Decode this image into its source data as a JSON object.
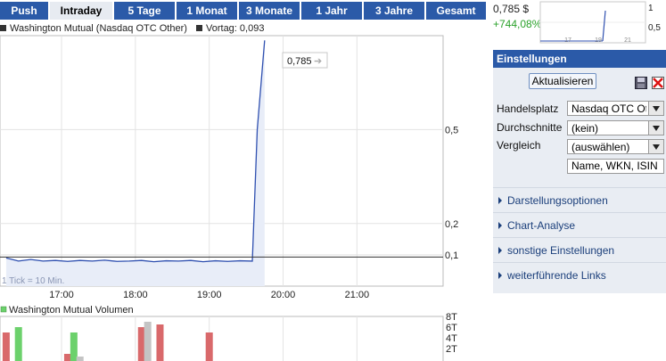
{
  "tabs": [
    {
      "label": "Push",
      "active": false
    },
    {
      "label": "Intraday",
      "active": true
    },
    {
      "label": "5 Tage",
      "active": false
    },
    {
      "label": "1 Monat",
      "active": false
    },
    {
      "label": "3 Monate",
      "active": false
    },
    {
      "label": "1 Jahr",
      "active": false
    },
    {
      "label": "3 Jahre",
      "active": false
    },
    {
      "label": "Gesamt",
      "active": false
    }
  ],
  "legend": {
    "series_name": "Washington Mutual (Nasdaq OTC Other)",
    "prev_close_label": "Vortag: 0,093"
  },
  "main_chart": {
    "callout": "0,785",
    "tick_note": "1 Tick = 10 Min.",
    "y_ticks": [
      "0,5",
      "0,2",
      "0,1"
    ],
    "x_ticks": [
      "17:00",
      "18:00",
      "19:00",
      "20:00",
      "21:00"
    ]
  },
  "volume_chart": {
    "title": "Washington Mutual Volumen",
    "y_ticks": [
      "8T",
      "6T",
      "4T",
      "2T"
    ]
  },
  "quote": {
    "price": "0,785 $",
    "change": "+744,08%"
  },
  "mini_chart": {
    "y_ticks": [
      "1",
      "0,5"
    ],
    "x_ticks": [
      "17",
      "19",
      "21"
    ]
  },
  "settings": {
    "title": "Einstellungen",
    "update_button": "Aktualisieren",
    "rows": [
      {
        "label": "Handelsplatz",
        "value": "Nasdaq OTC Other"
      },
      {
        "label": "Durchschnitte",
        "value": "(kein)"
      },
      {
        "label": "Vergleich",
        "value": "(auswählen)"
      }
    ],
    "search_value": "Name, WKN, ISIN",
    "options": [
      "Darstellungsoptionen",
      "Chart-Analyse",
      "sonstige Einstellungen",
      "weiterführende Links"
    ]
  },
  "colors": {
    "tab_bg": "#2b5aa8",
    "line": "#2f50b0",
    "area": "#e8edf8",
    "vol_green": "#6cd16c",
    "vol_red": "#d9696b",
    "vol_grey": "#c4c4c4",
    "change_green": "#2aa12a"
  },
  "chart_data": {
    "type": "line",
    "title": "",
    "xlabel": "",
    "ylabel": "",
    "x_ticks": [
      "17:00",
      "18:00",
      "19:00",
      "20:00",
      "21:00"
    ],
    "ylim": [
      0.0,
      0.8
    ],
    "reference": {
      "label": "Vortag",
      "value": 0.093
    },
    "series": [
      {
        "name": "Washington Mutual (Nasdaq OTC Other)",
        "x": [
          "16:15",
          "16:25",
          "16:35",
          "16:45",
          "16:55",
          "17:05",
          "17:15",
          "17:25",
          "17:35",
          "17:45",
          "17:55",
          "18:05",
          "18:15",
          "18:25",
          "18:35",
          "18:45",
          "18:55",
          "19:05",
          "19:15",
          "19:25",
          "19:35",
          "19:39",
          "19:45"
        ],
        "values": [
          0.09,
          0.08,
          0.085,
          0.08,
          0.082,
          0.079,
          0.082,
          0.08,
          0.083,
          0.079,
          0.08,
          0.082,
          0.078,
          0.081,
          0.08,
          0.082,
          0.078,
          0.081,
          0.079,
          0.081,
          0.08,
          0.5,
          0.785
        ]
      }
    ],
    "volume": {
      "name": "Washington Mutual Volumen",
      "unit": "T",
      "ylim": [
        0,
        8
      ],
      "bars": [
        {
          "x": "16:15",
          "value": 5,
          "color": "red"
        },
        {
          "x": "16:25",
          "value": 6,
          "color": "green"
        },
        {
          "x": "17:05",
          "value": 1,
          "color": "red"
        },
        {
          "x": "17:10",
          "value": 5,
          "color": "green"
        },
        {
          "x": "17:15",
          "value": 0.5,
          "color": "grey"
        },
        {
          "x": "18:05",
          "value": 6,
          "color": "red"
        },
        {
          "x": "18:10",
          "value": 7,
          "color": "grey"
        },
        {
          "x": "18:20",
          "value": 6.5,
          "color": "red"
        },
        {
          "x": "19:00",
          "value": 5,
          "color": "red"
        }
      ]
    }
  }
}
